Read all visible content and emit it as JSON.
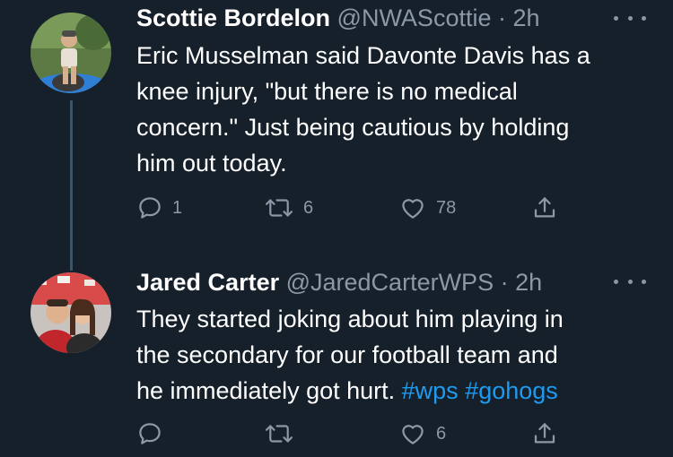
{
  "tweets": [
    {
      "name": "Scottie Bordelon",
      "handle": "@NWAScottie",
      "separator": "·",
      "time": "2h",
      "text_lines": [
        "Eric Musselman said Davonte Davis has a",
        "knee injury, \"but there is no medical",
        "concern.\" Just being cautious by holding",
        "him out today."
      ],
      "reply_count": "1",
      "retweet_count": "6",
      "like_count": "78"
    },
    {
      "name": "Jared Carter",
      "handle": "@JaredCarterWPS",
      "separator": "·",
      "time": "2h",
      "text_lines": [
        "They started joking about him playing in",
        "the secondary for our football team and",
        "he immediately got hurt."
      ],
      "hashtags": [
        "#wps",
        "#gohogs"
      ],
      "reply_count": "",
      "retweet_count": "",
      "like_count": "6"
    }
  ],
  "colors": {
    "background": "#15202b",
    "text": "#ffffff",
    "muted": "#8b98a5",
    "accent": "#1d9bf0"
  },
  "icons": [
    "reply-icon",
    "retweet-icon",
    "like-icon",
    "share-icon",
    "more-options-icon"
  ]
}
